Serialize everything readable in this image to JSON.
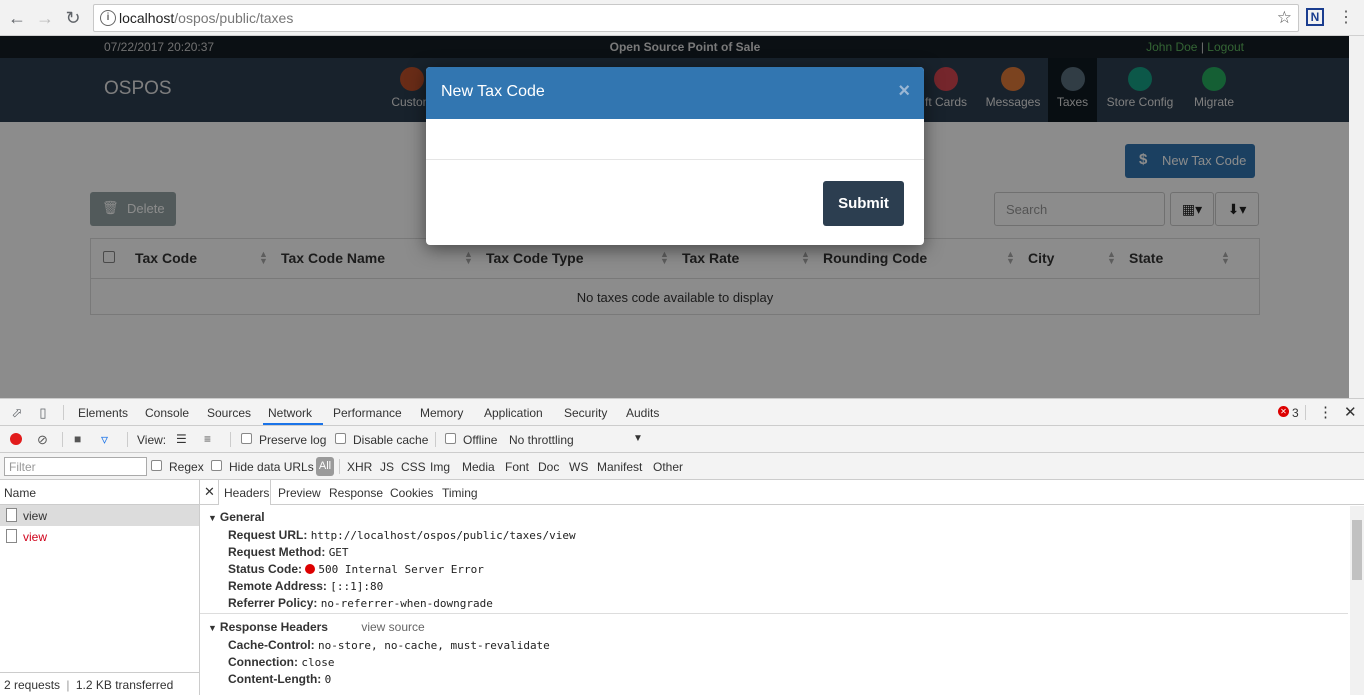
{
  "browser": {
    "url_host": "localhost",
    "url_path": "/ospos/public/taxes"
  },
  "app": {
    "datetime": "07/22/2017 20:20:37",
    "app_title": "Open Source Point of Sale",
    "user_name": "John Doe",
    "user_sep": "|",
    "logout": "Logout",
    "brand": "OSPOS",
    "nav": [
      {
        "label": "Custom",
        "color": "#c0502a"
      },
      {
        "label": "ft Cards",
        "color": "#d64550"
      },
      {
        "label": "Messages",
        "color": "#e07b39"
      },
      {
        "label": "Taxes",
        "color": "#34495e"
      },
      {
        "label": "Store Config",
        "color": "#16a085"
      },
      {
        "label": "Migrate",
        "color": "#27ae60"
      }
    ],
    "new_tax_code_button": "New Tax Code",
    "delete_button": "Delete",
    "search_placeholder": "Search",
    "table": {
      "columns": [
        "Tax Code",
        "Tax Code Name",
        "Tax Code Type",
        "Tax Rate",
        "Rounding Code",
        "City",
        "State"
      ],
      "empty_message": "No taxes code available to display"
    },
    "modal": {
      "title": "New Tax Code",
      "close": "×",
      "submit": "Submit"
    }
  },
  "devtools": {
    "tabs": [
      "Elements",
      "Console",
      "Sources",
      "Network",
      "Performance",
      "Memory",
      "Application",
      "Security",
      "Audits"
    ],
    "active_tab": "Network",
    "error_count": "3",
    "toolbar": {
      "view_label": "View:",
      "preserve_log": "Preserve log",
      "disable_cache": "Disable cache",
      "offline": "Offline",
      "throttling": "No throttling"
    },
    "filter": {
      "placeholder": "Filter",
      "regex": "Regex",
      "hide_data_urls": "Hide data URLs",
      "types": [
        "All",
        "XHR",
        "JS",
        "CSS",
        "Img",
        "Media",
        "Font",
        "Doc",
        "WS",
        "Manifest",
        "Other"
      ]
    },
    "requests": {
      "name_header": "Name",
      "items": [
        {
          "name": "view",
          "status": "ok"
        },
        {
          "name": "view",
          "status": "error"
        }
      ],
      "summary_count": "2 requests",
      "summary_transferred": "1.2 KB transferred"
    },
    "detail_tabs": [
      "Headers",
      "Preview",
      "Response",
      "Cookies",
      "Timing"
    ],
    "general": {
      "title": "General",
      "rows": [
        {
          "key": "Request URL:",
          "value": "http://localhost/ospos/public/taxes/view"
        },
        {
          "key": "Request Method:",
          "value": "GET"
        },
        {
          "key": "Status Code:",
          "value": "500 Internal Server Error"
        },
        {
          "key": "Remote Address:",
          "value": "[::1]:80"
        },
        {
          "key": "Referrer Policy:",
          "value": "no-referrer-when-downgrade"
        }
      ]
    },
    "response_headers": {
      "title": "Response Headers",
      "view_source": "view source",
      "rows": [
        {
          "key": "Cache-Control:",
          "value": "no-store, no-cache, must-revalidate"
        },
        {
          "key": "Connection:",
          "value": "close"
        },
        {
          "key": "Content-Length:",
          "value": "0"
        }
      ]
    }
  }
}
